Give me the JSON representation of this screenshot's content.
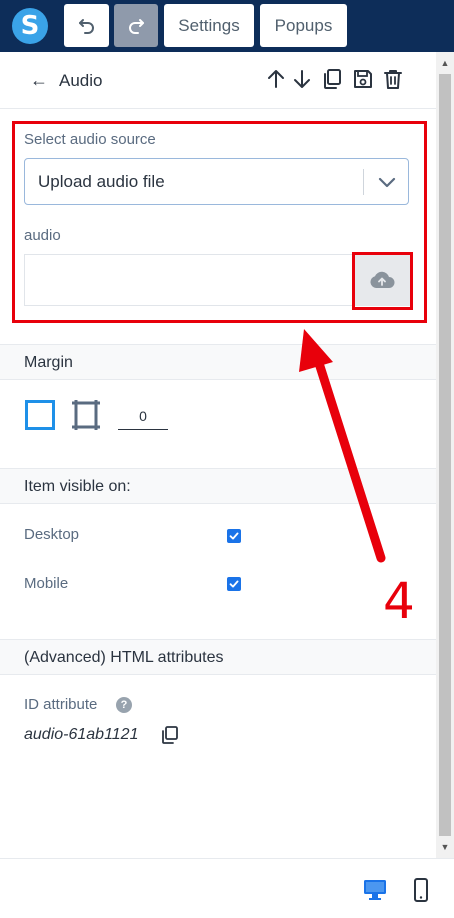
{
  "topbar": {
    "logo_letter": "S",
    "settings_label": "Settings",
    "popups_label": "Popups"
  },
  "panel": {
    "title": "Audio"
  },
  "audio_source": {
    "label": "Select audio source",
    "selected": "Upload audio file"
  },
  "audio_field": {
    "label": "audio",
    "value": ""
  },
  "margin": {
    "title": "Margin",
    "value": "0"
  },
  "visibility": {
    "title": "Item visible on:",
    "desktop_label": "Desktop",
    "desktop_checked": true,
    "mobile_label": "Mobile",
    "mobile_checked": true
  },
  "advanced": {
    "title": "(Advanced) HTML attributes",
    "id_label": "ID attribute",
    "help_mark": "?",
    "id_value": "audio-61ab1121"
  },
  "annotation": {
    "step_number": "4"
  },
  "colors": {
    "topbar": "#0d2d59",
    "accent": "#1a73e8",
    "highlight": "#e8000b"
  }
}
